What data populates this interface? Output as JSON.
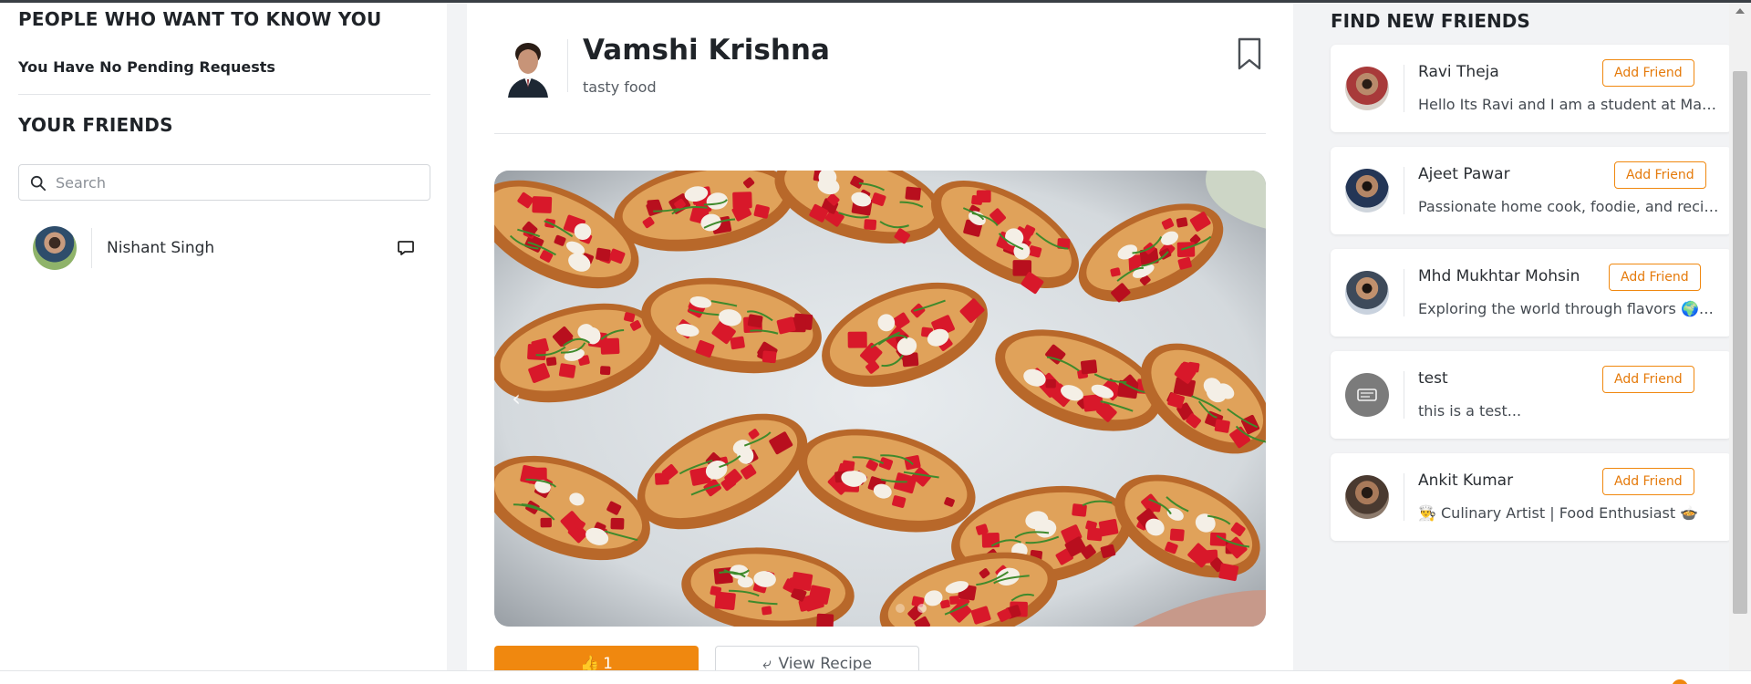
{
  "left": {
    "pending_title": "PEOPLE WHO WANT TO KNOW YOU",
    "pending_empty": "You Have No Pending Requests",
    "friends_title": "YOUR FRIENDS",
    "search_placeholder": "Search",
    "friends": [
      {
        "name": "Nishant Singh",
        "action_icon": "message-icon"
      }
    ]
  },
  "post": {
    "author": "Vamshi Krishna",
    "caption": "tasty food",
    "bookmark_icon": "bookmark-icon",
    "image_description_icon": "bruschetta-image",
    "carousel_dots": 2,
    "like_count": "1",
    "view_recipe_label": "View Recipe"
  },
  "right": {
    "title": "FIND NEW FRIENDS",
    "add_label": "Add Friend",
    "suggestions": [
      {
        "name": "Ravi Theja",
        "bio": "Hello Its Ravi and I am a student at Masai School"
      },
      {
        "name": "Ajeet Pawar",
        "bio": "Passionate home cook, foodie, and recipe explorer"
      },
      {
        "name": "Mhd Mukhtar Mohsin",
        "bio": "Exploring the world through flavors 🌍🍽…"
      },
      {
        "name": "test",
        "bio": "this is a test..."
      },
      {
        "name": "Ankit Kumar",
        "bio": "👨‍🍳 Culinary Artist | Food Enthusiast 🍲"
      }
    ]
  },
  "colors": {
    "accent": "#f0880f",
    "text_dark": "#1f2328",
    "background": "#f2f3f5"
  }
}
